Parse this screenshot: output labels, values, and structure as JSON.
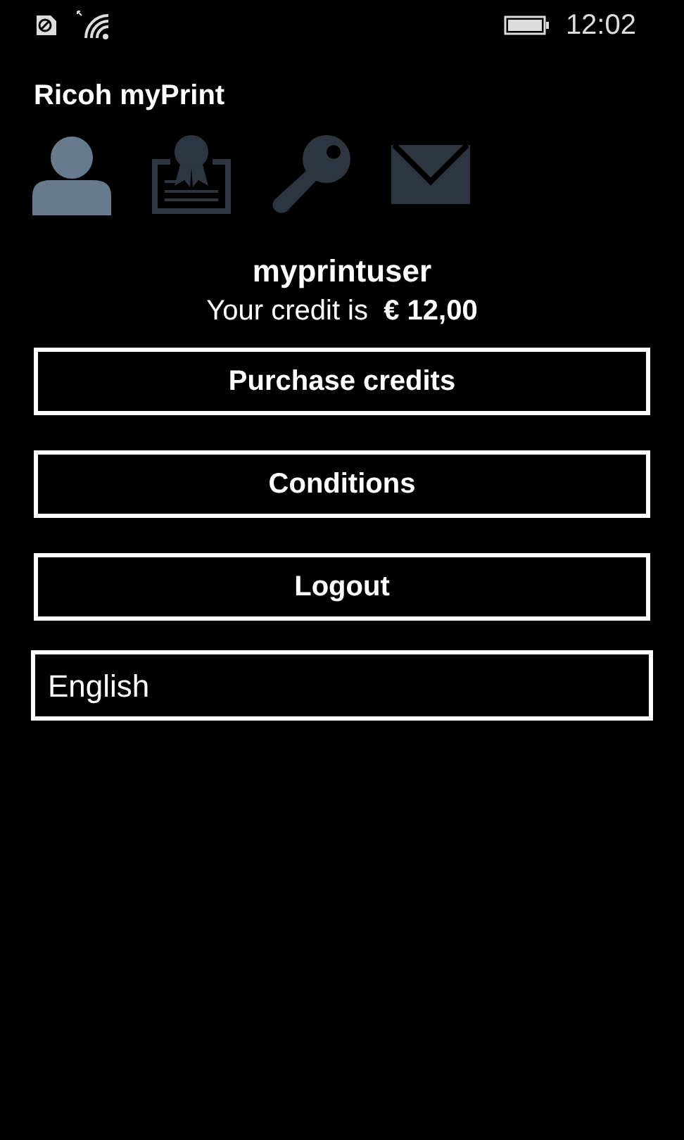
{
  "status_bar": {
    "time": "12:02"
  },
  "app": {
    "title": "Ricoh myPrint"
  },
  "tabs": [
    {
      "kind": "user",
      "selected": true
    },
    {
      "kind": "certificate",
      "selected": false
    },
    {
      "kind": "key",
      "selected": false
    },
    {
      "kind": "mail",
      "selected": false
    }
  ],
  "account": {
    "username": "myprintuser",
    "credit": "Your credit is  **€ 12,00**"
  },
  "buttons": [
    "Purchase credits",
    "Conditions",
    "Logout"
  ],
  "language": {
    "value": "English"
  }
}
